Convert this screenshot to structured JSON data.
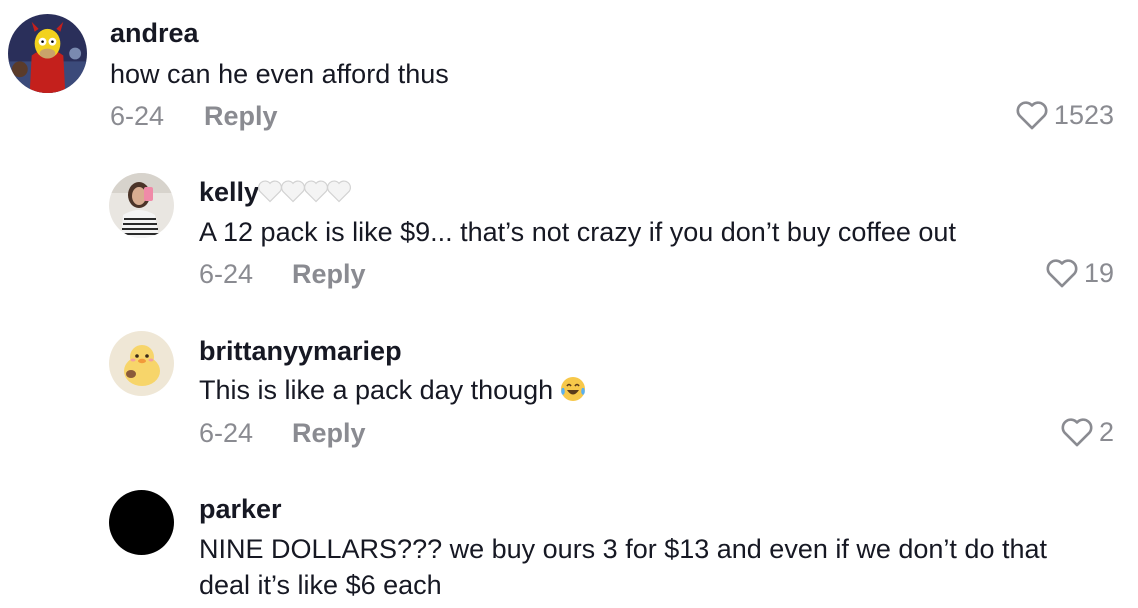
{
  "comments": [
    {
      "username": "andrea",
      "text": "how can he even afford thus",
      "date": "6-24",
      "reply_label": "Reply",
      "likes": "1523"
    },
    {
      "username": "kelly",
      "username_suffix": "🤍🤍🤍🤍",
      "text": "A 12 pack is like $9... that’s not crazy if you don’t buy coffee out",
      "date": "6-24",
      "reply_label": "Reply",
      "likes": "19"
    },
    {
      "username": "brittanyymariep",
      "text": "This is like a pack day though",
      "text_emoji": "😂",
      "date": "6-24",
      "reply_label": "Reply",
      "likes": "2"
    },
    {
      "username": "parker",
      "text_line1": "NINE DOLLARS??? we buy ours 3 for $13 and even if we don’t do that",
      "text_line2": "deal it’s like $6 each"
    }
  ],
  "colors": {
    "text": "#161823",
    "muted": "#8a8b91",
    "background": "#ffffff"
  }
}
